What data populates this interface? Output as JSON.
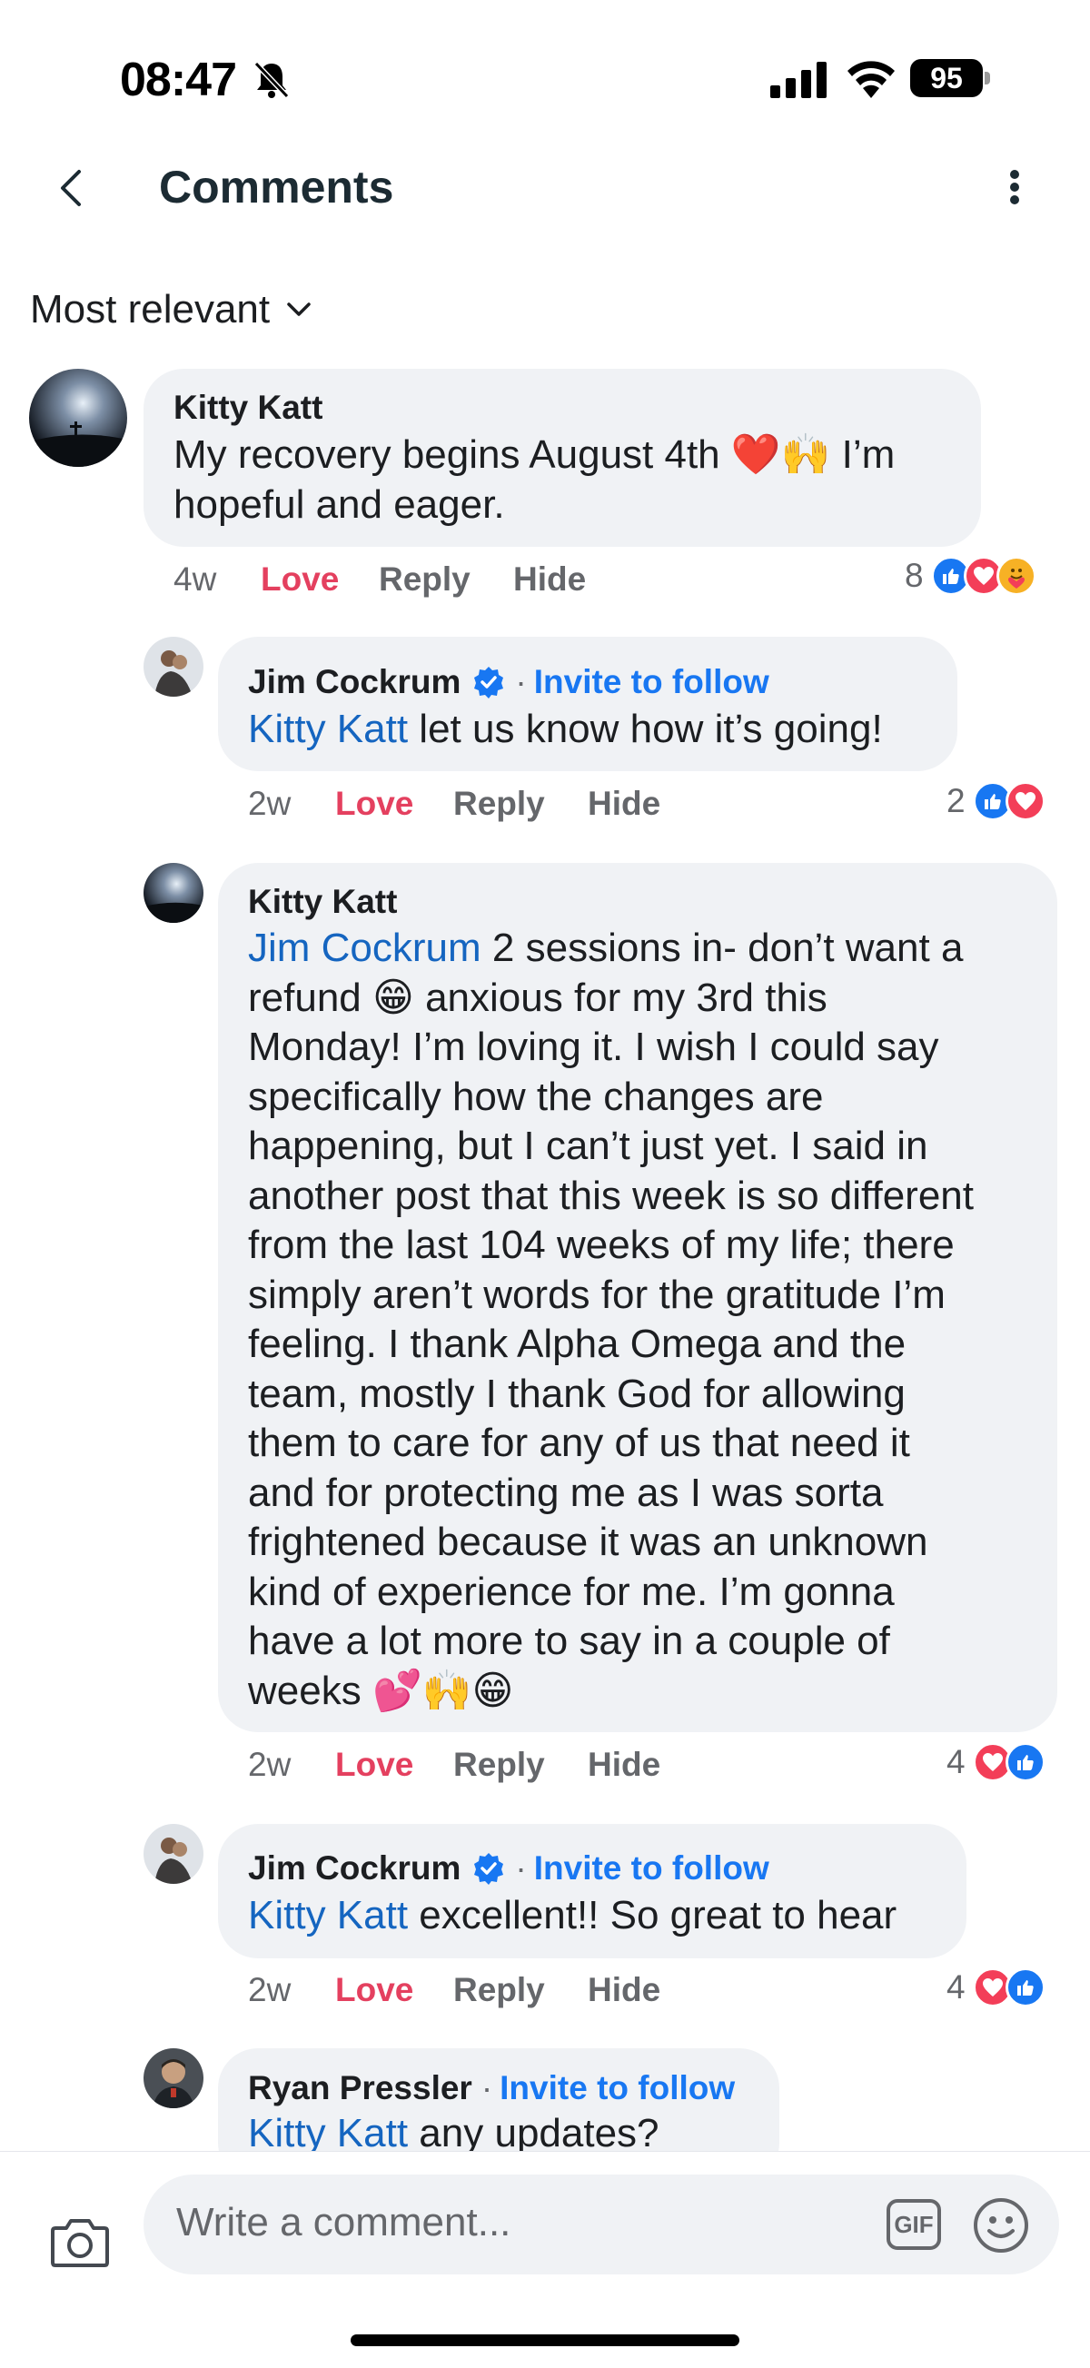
{
  "status_bar": {
    "time": "08:47",
    "battery": "95"
  },
  "header": {
    "title": "Comments"
  },
  "sort": {
    "label": "Most relevant"
  },
  "comments": [
    {
      "author": "Kitty Katt",
      "text_plain": "My recovery begins August 4th ❤️🙌 I’m hopeful and eager.",
      "age": "4w",
      "love": "Love",
      "reply": "Reply",
      "hide": "Hide",
      "reaction_count": "8"
    },
    {
      "author": "Jim Cockrum",
      "invite": "Invite to follow",
      "mention": "Kitty Katt",
      "text": " let us know how it’s going!",
      "age": "2w",
      "love": "Love",
      "reply": "Reply",
      "hide": "Hide",
      "reaction_count": "2"
    },
    {
      "author": "Kitty Katt",
      "mention": "Jim Cockrum",
      "lines": [
        " 2 sessions in- don’t want a",
        "refund 😁 anxious for my 3rd this",
        "Monday! I’m loving it. I wish I could say",
        "specifically how the changes are",
        "happening, but I can’t just yet. I said in",
        "another post that this week is so different",
        "from the last 104 weeks of my life; there",
        "simply aren’t words for the gratitude I’m",
        "feeling. I thank Alpha Omega and the",
        "team, mostly I thank God for allowing",
        "them to care for any of us that need it",
        "and for protecting me as I was sorta",
        "frightened because it was an unknown",
        "kind of experience for me. I’m gonna",
        "have a lot more to say in a couple of",
        "weeks 💕🙌😁"
      ],
      "age": "2w",
      "love": "Love",
      "reply": "Reply",
      "hide": "Hide",
      "reaction_count": "4"
    },
    {
      "author": "Jim Cockrum",
      "invite": "Invite to follow",
      "mention": "Kitty Katt",
      "text": " excellent!! So great to hear",
      "age": "2w",
      "love": "Love",
      "reply": "Reply",
      "hide": "Hide",
      "reaction_count": "4"
    },
    {
      "author": "Ryan Pressler",
      "invite": "Invite to follow",
      "mention": "Kitty Katt",
      "text": " any updates?"
    }
  ],
  "composer": {
    "placeholder": "Write a comment...",
    "gif_label": "GIF"
  },
  "colors": {
    "accent": "#1877f2",
    "love": "#e4405f",
    "bubble": "#f0f2f5",
    "muted": "#65676b"
  },
  "icons": [
    "bell-off-icon",
    "signal-icon",
    "wifi-icon",
    "battery-icon",
    "back-arrow-icon",
    "more-vertical-icon",
    "chevron-down-icon",
    "verified-badge-icon",
    "like-reaction-icon",
    "love-reaction-icon",
    "care-reaction-icon",
    "camera-icon",
    "gif-icon",
    "emoji-icon"
  ]
}
